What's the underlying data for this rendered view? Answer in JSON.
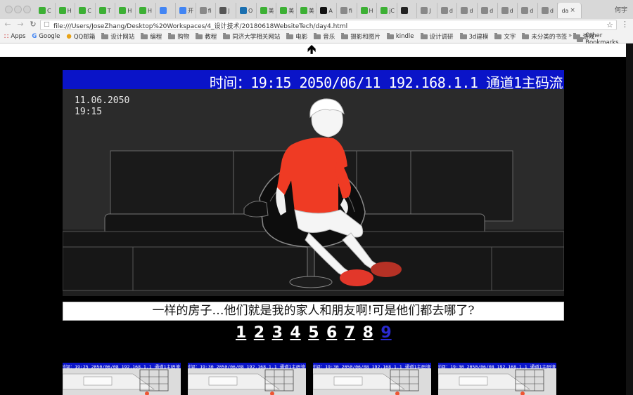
{
  "browser": {
    "tabs": [
      {
        "label": "C",
        "icon": "wechat-icon",
        "color": "#3cb034"
      },
      {
        "label": "H",
        "icon": "wechat-icon",
        "color": "#3cb034"
      },
      {
        "label": "C",
        "icon": "wechat-icon",
        "color": "#3cb034"
      },
      {
        "label": "T",
        "icon": "wechat-icon",
        "color": "#3cb034"
      },
      {
        "label": "H",
        "icon": "wechat-icon",
        "color": "#3cb034"
      },
      {
        "label": "H",
        "icon": "wechat-icon",
        "color": "#3cb034"
      },
      {
        "label": "",
        "icon": "google-icon",
        "color": "#4285f4"
      },
      {
        "label": "开",
        "icon": "google-icon",
        "color": "#4285f4"
      },
      {
        "label": "fi",
        "icon": "page-icon",
        "color": "#888888"
      },
      {
        "label": "J",
        "icon": "person-icon",
        "color": "#555555"
      },
      {
        "label": "O",
        "icon": "bird-icon",
        "color": "#1a6fb0"
      },
      {
        "label": "美",
        "icon": "chat-icon",
        "color": "#3cb034"
      },
      {
        "label": "美",
        "icon": "chat-icon",
        "color": "#3cb034"
      },
      {
        "label": "美",
        "icon": "chat-icon",
        "color": "#3cb034"
      },
      {
        "label": "A",
        "icon": "circle-icon",
        "color": "#111111"
      },
      {
        "label": "fi",
        "icon": "page-icon",
        "color": "#888888"
      },
      {
        "label": "H",
        "icon": "wechat-icon",
        "color": "#3cb034"
      },
      {
        "label": "jC",
        "icon": "wechat-icon",
        "color": "#3cb034"
      },
      {
        "label": "",
        "icon": "github-icon",
        "color": "#222222"
      },
      {
        "label": "J",
        "icon": "page-icon",
        "color": "#888888"
      },
      {
        "label": "d",
        "icon": "page-icon",
        "color": "#888888"
      },
      {
        "label": "d",
        "icon": "page-icon",
        "color": "#888888"
      },
      {
        "label": "d",
        "icon": "page-icon",
        "color": "#888888"
      },
      {
        "label": "d",
        "icon": "page-icon",
        "color": "#888888"
      },
      {
        "label": "d",
        "icon": "page-icon",
        "color": "#888888"
      },
      {
        "label": "d",
        "icon": "page-icon",
        "color": "#888888"
      }
    ],
    "active_tab": {
      "label": "da",
      "close": "×"
    },
    "profile_name": "何宇",
    "url": "file:///Users/JoseZhang/Desktop%20Workspaces/4_设计技术/20180618WebsiteTech/day4.html",
    "bookmarks": [
      {
        "label": "Apps",
        "type": "apps"
      },
      {
        "label": "Google",
        "type": "google"
      },
      {
        "label": "QQ邮箱",
        "type": "qq"
      },
      {
        "label": "设计网站",
        "type": "folder"
      },
      {
        "label": "编程",
        "type": "folder"
      },
      {
        "label": "购物",
        "type": "folder"
      },
      {
        "label": "教程",
        "type": "folder"
      },
      {
        "label": "同济大学相关网站",
        "type": "folder"
      },
      {
        "label": "电影",
        "type": "folder"
      },
      {
        "label": "音乐",
        "type": "folder"
      },
      {
        "label": "摄影和图片",
        "type": "folder"
      },
      {
        "label": "kindle",
        "type": "folder"
      },
      {
        "label": "设计调研",
        "type": "folder"
      },
      {
        "label": "3d建模",
        "type": "folder"
      },
      {
        "label": "文字",
        "type": "folder"
      },
      {
        "label": "未分类的书签",
        "type": "folder"
      },
      {
        "label": "游戏",
        "type": "folder"
      }
    ],
    "bookmarks_more": "»",
    "other_bookmarks": "Other Bookmarks"
  },
  "page": {
    "up_arrow": "🡹",
    "cctv": {
      "bar_text": "时间：19:15 2050/06/11 192.168.1.1 通道1主码流",
      "date": "11.06.2050",
      "time": "19:15",
      "bar_color": "#0a14c8",
      "shirt_color": "#ef3b24"
    },
    "subtitle": "一样的房子…他们就是我的家人和朋友啊!可是他们都去哪了?",
    "pages": [
      "1",
      "2",
      "3",
      "4",
      "5",
      "6",
      "7",
      "8",
      "9"
    ],
    "current_page": "9",
    "thumbnails": [
      {
        "bar_text": "时间：19:25 2050/06/08 192.168.1.1 通道1主码流"
      },
      {
        "bar_text": "时间：19:30 2050/06/08 192.168.1.1 通道1主码流"
      },
      {
        "bar_text": "时间：19:30 2050/06/08 192.168.1.1 通道1主码流"
      },
      {
        "bar_text": "时间：19:30 2050/06/08 192.168.1.1 通道1主码流"
      }
    ]
  }
}
